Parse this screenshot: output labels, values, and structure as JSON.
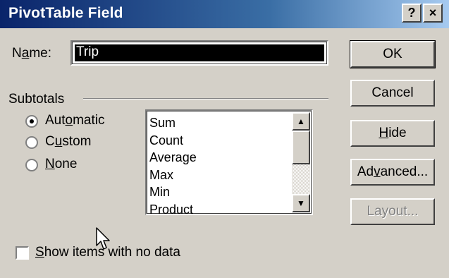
{
  "window": {
    "title": "PivotTable Field",
    "help_label": "?",
    "close_label": "×"
  },
  "name": {
    "label_pre": "N",
    "label_accel": "a",
    "label_post": "me:",
    "value": "Trip"
  },
  "buttons": {
    "ok": "OK",
    "cancel": "Cancel",
    "hide_accel": "H",
    "hide_rest": "ide",
    "advanced_pre": "Ad",
    "advanced_accel": "v",
    "advanced_post": "anced...",
    "layout": "Layout..."
  },
  "subtotals": {
    "label": "Subtotals",
    "options": [
      {
        "pre": "Aut",
        "accel": "o",
        "post": "matic",
        "selected": true
      },
      {
        "pre": "C",
        "accel": "u",
        "post": "stom",
        "selected": false
      },
      {
        "pre": "",
        "accel": "N",
        "post": "one",
        "selected": false
      }
    ],
    "functions": [
      "Sum",
      "Count",
      "Average",
      "Max",
      "Min",
      "Product"
    ]
  },
  "show_items": {
    "accel": "S",
    "rest": "how items with no data",
    "checked": false
  },
  "icons": {
    "radio_selected": "radio-selected-icon",
    "cursor": "mouse-pointer-icon"
  },
  "colors": {
    "titlebar_start": "#0a246a",
    "titlebar_end": "#a6caf0",
    "face": "#d4d0c8"
  }
}
